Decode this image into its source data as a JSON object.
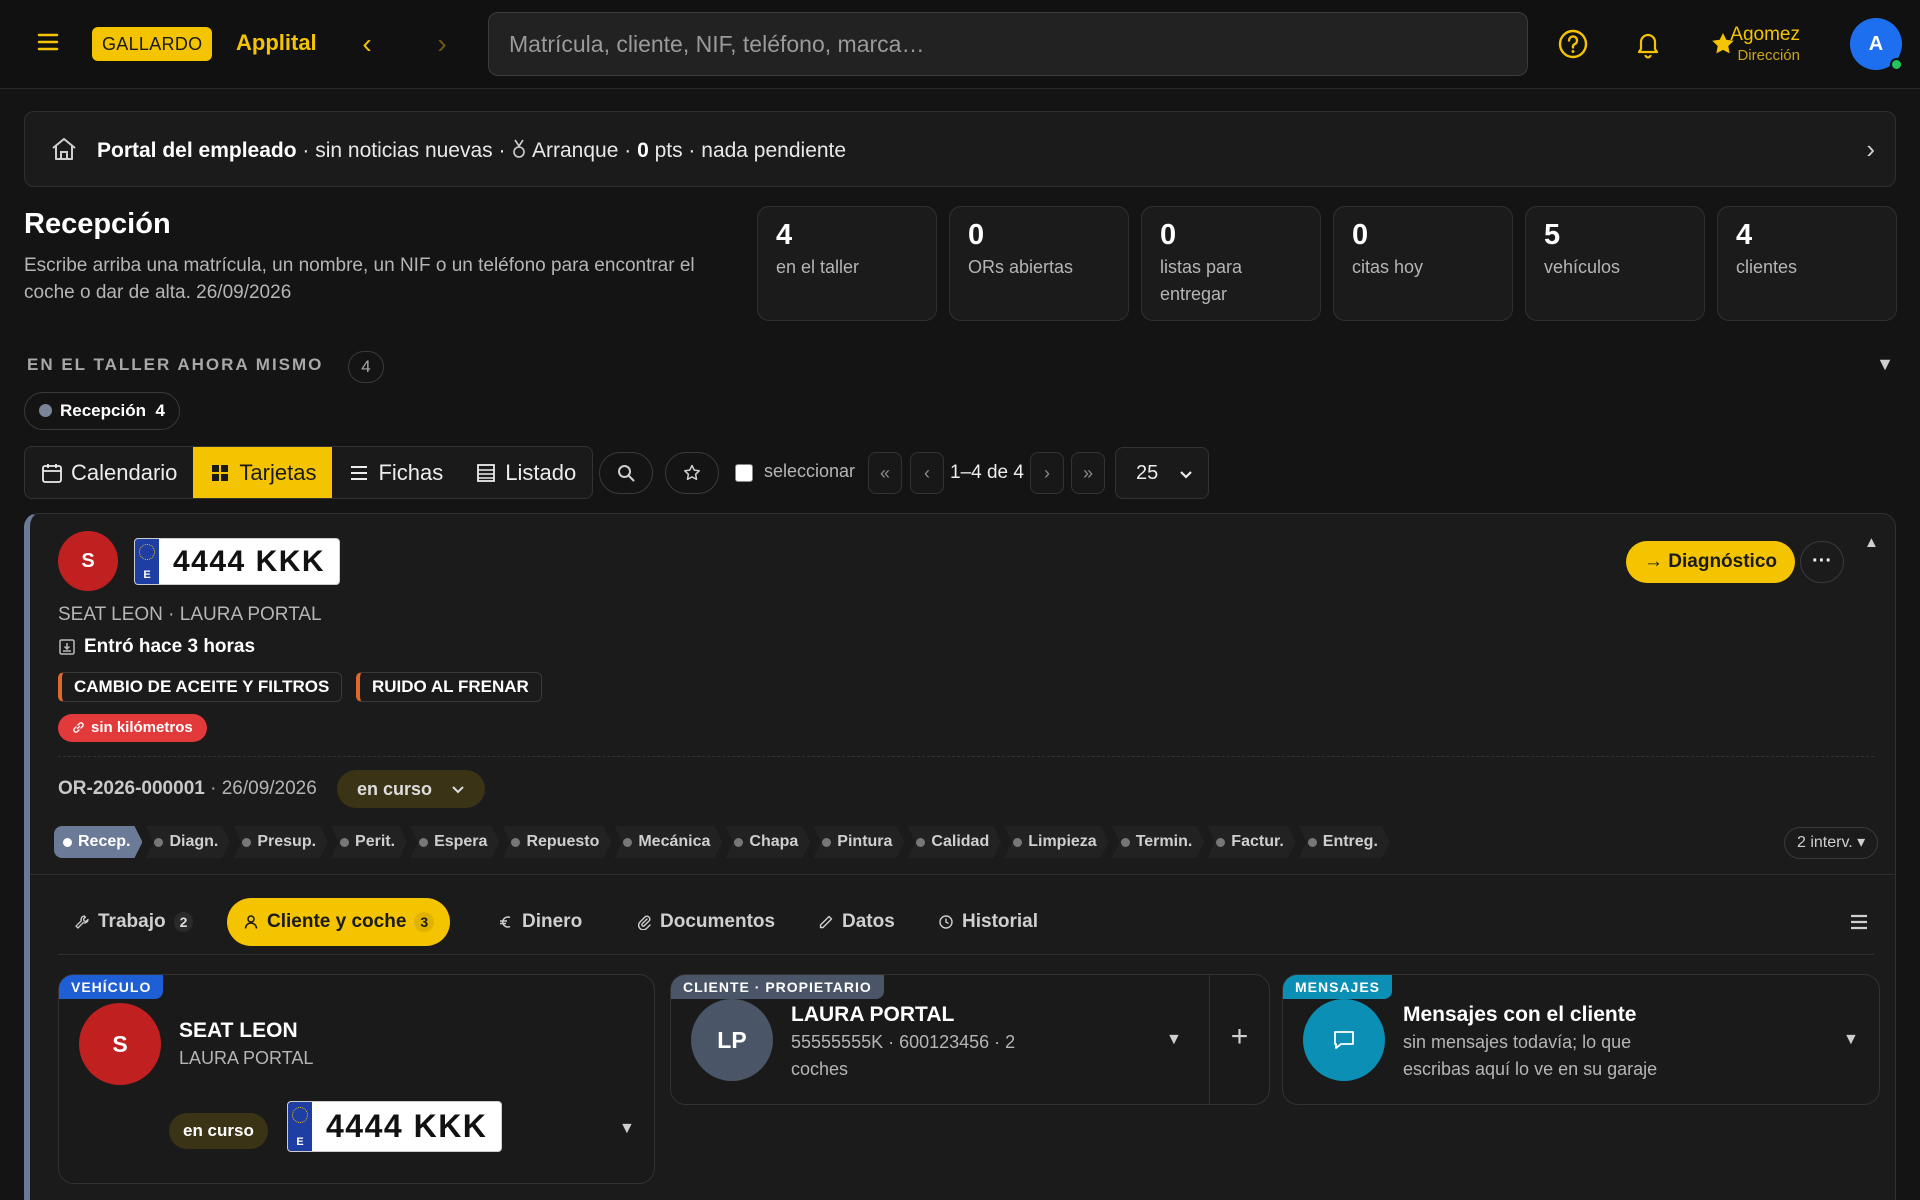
{
  "topbar": {
    "brand_badge": "GALLARDO",
    "brand_name": "Applital",
    "back": "‹",
    "forward": "›",
    "search_placeholder": "Matrícula, cliente, NIF, teléfono, marca…",
    "user_name": "Agomez",
    "user_role": "Dirección",
    "avatar_initial": "A",
    "accent_color": "#f5c400"
  },
  "portal": {
    "title": "Portal del empleado",
    "news": " · sin noticias nuevas · ",
    "level": " Arranque · ",
    "points": "0",
    "points_suffix": " pts · nada pendiente",
    "chevron": "›"
  },
  "reception": {
    "title": "Recepción",
    "subtitle": "Escribe arriba una matrícula, un nombre, un NIF o un teléfono para encontrar el coche o dar de alta. 26/09/2026",
    "stats": [
      {
        "value": "4",
        "label": "en el taller"
      },
      {
        "value": "0",
        "label": "ORs abiertas"
      },
      {
        "value": "0",
        "label": "listas para entregar"
      },
      {
        "value": "0",
        "label": "citas hoy"
      },
      {
        "value": "5",
        "label": "vehículos"
      },
      {
        "value": "4",
        "label": "clientes"
      }
    ]
  },
  "section": {
    "title": "EN EL TALLER AHORA MISMO",
    "count": "4",
    "toggle": "▼",
    "chip_label": "Recepción",
    "chip_count": "4"
  },
  "views": {
    "items": [
      "Calendario",
      "Tarjetas",
      "Fichas",
      "Listado"
    ],
    "active": "Tarjetas",
    "select_label": "seleccionar",
    "first": "«",
    "prev": "‹",
    "range": "1–4 de 4",
    "next": "›",
    "last": "»",
    "per_page": "25"
  },
  "card": {
    "avatar": "S",
    "plate": "4444 KKK",
    "plate_country": "E",
    "vehicle_line": "SEAT LEON · LAURA PORTAL",
    "entered": "Entró hace 3 horas",
    "tasks": [
      "CAMBIO DE ACEITE Y FILTROS",
      "RUIDO AL FRENAR"
    ],
    "warning": "sin kilómetros",
    "or_code": "OR-2026-000001",
    "or_date": " · 26/09/2026",
    "status": "en curso",
    "next_action": "→ Diagnóstico",
    "more": "···",
    "collapse": "▲",
    "stages": [
      "Recep.",
      "Diagn.",
      "Presup.",
      "Perit.",
      "Espera",
      "Repuesto",
      "Mecánica",
      "Chapa",
      "Pintura",
      "Calidad",
      "Limpieza",
      "Termin.",
      "Factur.",
      "Entreg."
    ],
    "active_stage": "Recep.",
    "interventions": "2 interv. ▾",
    "tabs": [
      {
        "label": "Trabajo",
        "count": "2"
      },
      {
        "label": "Cliente y coche",
        "count": "3"
      },
      {
        "label": "Dinero",
        "count": ""
      },
      {
        "label": "Documentos",
        "count": ""
      },
      {
        "label": "Datos",
        "count": ""
      },
      {
        "label": "Historial",
        "count": ""
      }
    ],
    "active_tab": "Cliente y coche"
  },
  "vehicle_panel": {
    "tag": "VEHÍCULO",
    "avatar": "S",
    "title": "SEAT LEON",
    "owner": "LAURA PORTAL",
    "status": "en curso",
    "plate": "4444 KKK",
    "caret": "▼"
  },
  "client_panel": {
    "tag": "CLIENTE · PROPIETARIO",
    "initials": "LP",
    "name": "LAURA PORTAL",
    "details": "55555555K · 600123456 · 2 coches",
    "caret": "▼",
    "add": "+"
  },
  "messages_panel": {
    "tag": "MENSAJES",
    "title": "Mensajes con el cliente",
    "subtitle": "sin mensajes todavía; lo que escribas aquí lo ve en su garaje",
    "caret": "▼"
  }
}
